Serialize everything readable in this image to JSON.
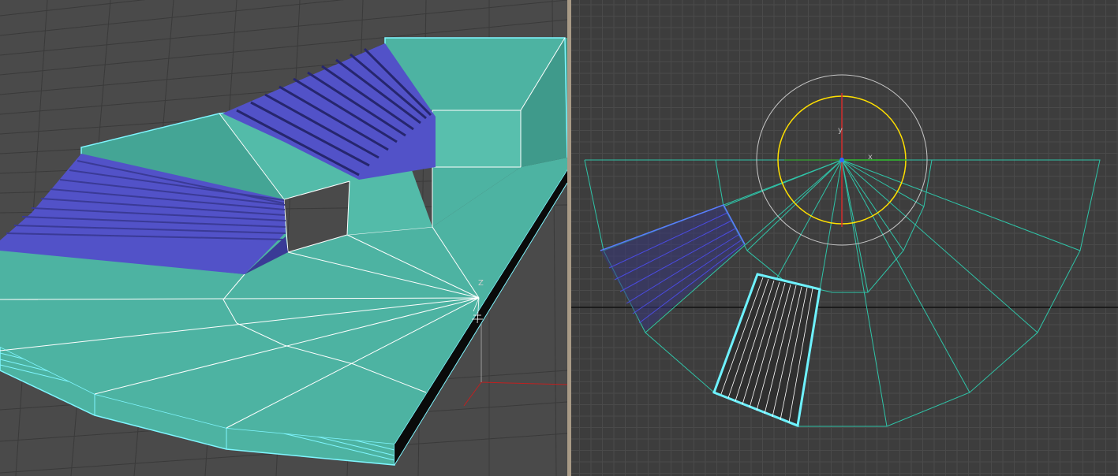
{
  "viewports": {
    "perspective": {
      "axis_labels": {
        "z": "Z"
      },
      "colors": {
        "background": "#4a4a4a",
        "grid": "#3a3a3a",
        "surface": "#4db3a2",
        "surface_dark": "#3f9a8b",
        "steps": "#5252c8",
        "steps_dark": "#3a3a96",
        "selection": "#7ff6ff",
        "edge": "#ffffff"
      }
    },
    "top": {
      "axis_labels": {
        "x": "x",
        "y": "y"
      },
      "colors": {
        "background": "#3d3d3d",
        "grid": "#4a4a4a",
        "wire": "#2fc4a8",
        "selection": "#6ef2ff",
        "gizmo_inner": "#ffe000",
        "gizmo_outer": "#c8c8c8",
        "axis_x": "#2fbf2f",
        "axis_y": "#d22a2a"
      }
    }
  }
}
